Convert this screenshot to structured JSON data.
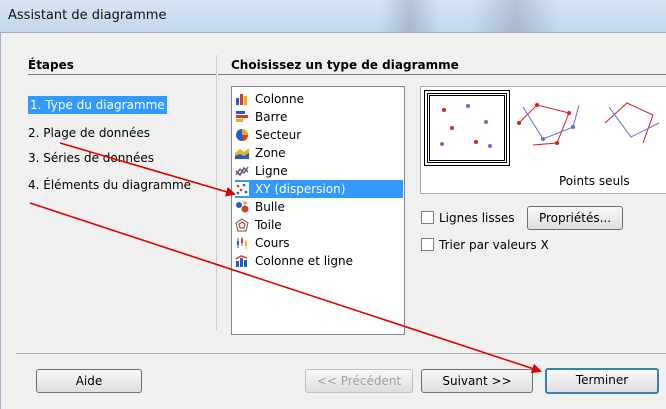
{
  "window": {
    "title": "Assistant de diagramme"
  },
  "steps": {
    "heading": "Étapes",
    "items": [
      "1. Type du diagramme",
      "2. Plage de données",
      "3. Séries de données",
      "4. Éléments du diagramme"
    ]
  },
  "main": {
    "heading": "Choisissez un type de diagramme",
    "types": [
      "Colonne",
      "Barre",
      "Secteur",
      "Zone",
      "Ligne",
      "XY (dispersion)",
      "Bulle",
      "Toile",
      "Cours",
      "Colonne et ligne"
    ],
    "selected_type": "XY (dispersion)",
    "preview_caption": "Points seuls",
    "options": {
      "smooth_lines": "Lignes lisses",
      "properties_button": "Propriétés...",
      "sort_by_x": "Trier par valeurs X"
    }
  },
  "buttons": {
    "help": "Aide",
    "previous": "<< Précédent",
    "next": "Suivant >>",
    "finish": "Terminer"
  },
  "colors": {
    "selection": "#3399ff",
    "annotation_arrow": "#e00000"
  }
}
